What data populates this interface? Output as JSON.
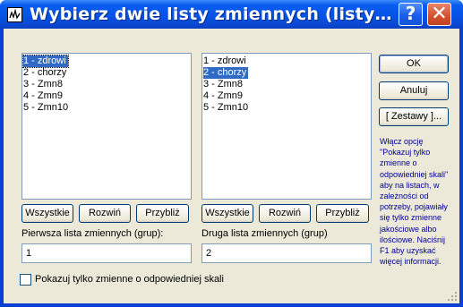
{
  "window": {
    "title": "Wybierz dwie listy zmiennych (listy…",
    "help_label": "?",
    "close_label": "✕"
  },
  "list1": {
    "items": [
      "1 - zdrowi",
      "2 - chorzy",
      "3 - Zmn8",
      "4 - Zmn9",
      "5 - Zmn10"
    ],
    "selected_index": 0
  },
  "list2": {
    "items": [
      "1 - zdrowi",
      "2 - chorzy",
      "3 - Zmn8",
      "4 - Zmn9",
      "5 - Zmn10"
    ],
    "selected_index": 1
  },
  "buttons": {
    "ok": "OK",
    "cancel": "Anuluj",
    "sets": "[ Zestawy ]...",
    "all1": "Wszystkie",
    "expand1": "Rozwiń",
    "near1": "Przybliż",
    "all2": "Wszystkie",
    "expand2": "Rozwiń",
    "near2": "Przybliż"
  },
  "fields": {
    "first_label": "Pierwsza lista zmiennych (grup):",
    "first_value": "1",
    "second_label": "Druga lista zmiennych (grup)",
    "second_value": "2"
  },
  "info_lines": [
    "Włącz opcję",
    "\"Pokazuj tylko",
    "zmienne o",
    "odpowiedniej skali\"",
    "aby na listach, w",
    "zależności od",
    "potrzeby, pojawiały",
    "się tylko zmienne",
    "jakościowe albo",
    "ilościowe. Naciśnij",
    "F1 aby uzyskać",
    "więcej informacji."
  ],
  "checkbox": {
    "label": "Pokazuj tylko zmienne o odpowiedniej skali",
    "checked": false
  },
  "colors": {
    "titlebar": "#0a5cf0",
    "selection": "#316ac5",
    "dialog_bg": "#ece9d8",
    "info_text": "#000099"
  }
}
